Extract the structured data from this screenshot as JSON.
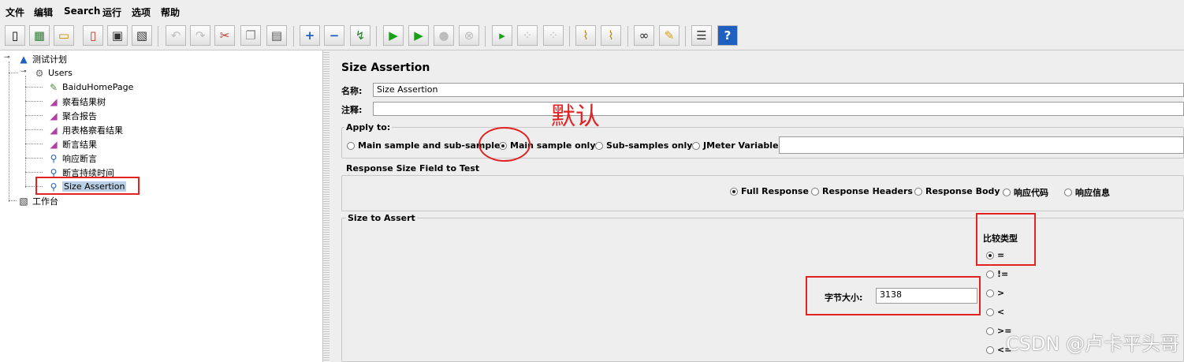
{
  "menu": [
    "文件",
    "编辑",
    "Search",
    "运行",
    "选项",
    "帮助"
  ],
  "toolbar": [
    {
      "name": "new-icon",
      "glyph": "▯"
    },
    {
      "name": "templates-icon",
      "glyph": "▦"
    },
    {
      "name": "open-icon",
      "glyph": "▭"
    },
    {
      "name": "open-recent-icon",
      "glyph": "▯"
    },
    {
      "name": "save-icon",
      "glyph": "▣"
    },
    {
      "name": "save-as-icon",
      "glyph": "▧"
    },
    {
      "name": "undo-icon",
      "glyph": "↶"
    },
    {
      "name": "redo-icon",
      "glyph": "↷"
    },
    {
      "name": "cut-icon",
      "glyph": "✂"
    },
    {
      "name": "copy-icon",
      "glyph": "❐"
    },
    {
      "name": "paste-icon",
      "glyph": "▤"
    },
    {
      "name": "expand-icon",
      "glyph": "+"
    },
    {
      "name": "collapse-icon",
      "glyph": "−"
    },
    {
      "name": "toggle-icon",
      "glyph": "↯"
    },
    {
      "name": "start-icon",
      "glyph": "▶"
    },
    {
      "name": "start-no-pause-icon",
      "glyph": "▶"
    },
    {
      "name": "stop-icon",
      "glyph": "●"
    },
    {
      "name": "shutdown-icon",
      "glyph": "⊗"
    },
    {
      "name": "remote-start-icon",
      "glyph": "▸"
    },
    {
      "name": "remote-stop-icon",
      "glyph": "⁘"
    },
    {
      "name": "remote-shutdown-icon",
      "glyph": "⁘"
    },
    {
      "name": "clear-icon",
      "glyph": "⌇"
    },
    {
      "name": "clear-all-icon",
      "glyph": "⌇"
    },
    {
      "name": "search-icon",
      "glyph": "∞"
    },
    {
      "name": "reset-search-icon",
      "glyph": "✎"
    },
    {
      "name": "function-helper-icon",
      "glyph": "☰"
    },
    {
      "name": "help-icon",
      "glyph": "?"
    }
  ],
  "tree": {
    "plan": "测试计划",
    "users": "Users",
    "children": [
      "BaiduHomePage",
      "察看结果树",
      "聚合报告",
      "用表格察看结果",
      "断言结果",
      "响应断言",
      "断言持续时间",
      "Size Assertion"
    ],
    "workbench": "工作台"
  },
  "panel": {
    "title": "Size Assertion",
    "name_label": "名称:",
    "name_value": "Size Assertion",
    "comment_label": "注释:",
    "comment_value": "",
    "apply_to": {
      "title": "Apply to:",
      "options": [
        "Main sample and sub-samples",
        "Main sample only",
        "Sub-samples only",
        "JMeter Variable"
      ],
      "selected": "Main sample only",
      "variable_value": ""
    },
    "response_field": {
      "title": "Response Size Field to Test",
      "options": [
        "Full Response",
        "Response Headers",
        "Response Body",
        "响应代码",
        "响应信息"
      ],
      "selected": "Full Response"
    },
    "size_to_assert": {
      "title": "Size to Assert",
      "compare_label": "比较类型",
      "size_label": "字节大小:",
      "size_value": "3138",
      "operators": [
        "=",
        "!=",
        ">",
        "<",
        ">=",
        "<="
      ],
      "selected_operator": "="
    }
  },
  "annotation": "默认",
  "watermark": "CSDN @卢卡平头哥",
  "colors": {
    "highlight": "#e32222",
    "selection": "#b8cfe5"
  }
}
